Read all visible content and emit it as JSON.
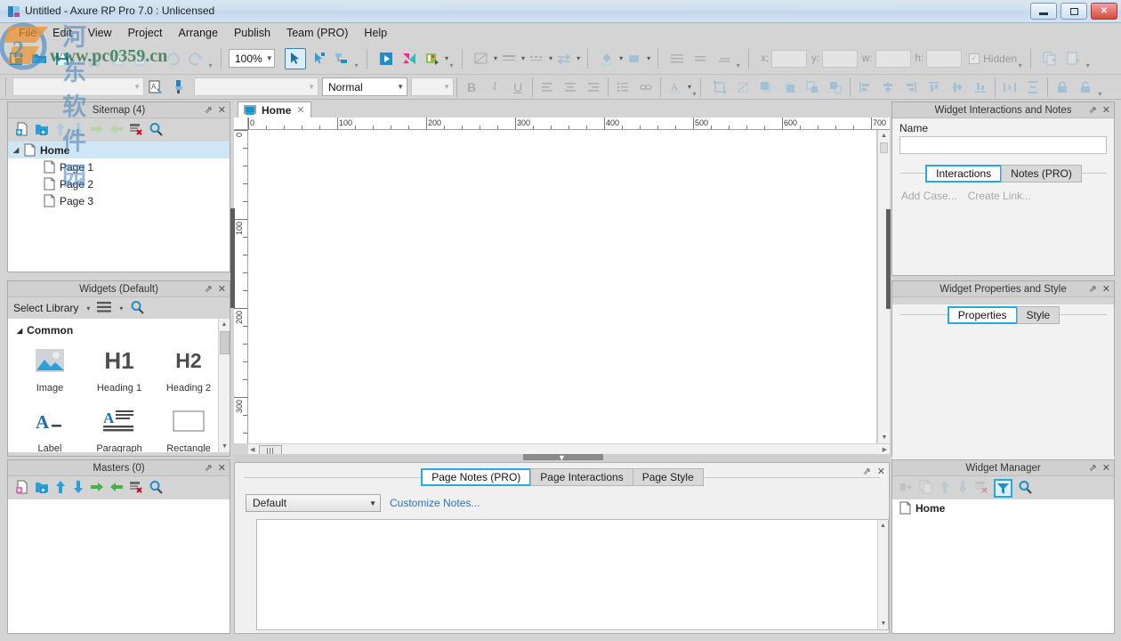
{
  "window": {
    "title": "Untitled - Axure RP Pro 7.0 : Unlicensed",
    "app_icon": "axure-logo-icon",
    "minimize": "minimize-icon",
    "maximize": "maximize-icon",
    "close": "close-icon"
  },
  "menubar": {
    "items": [
      "File",
      "Edit",
      "View",
      "Project",
      "Arrange",
      "Publish",
      "Team (PRO)",
      "Help"
    ]
  },
  "toolbar": {
    "file_group": [
      {
        "name": "new-file-icon",
        "enabled": true
      },
      {
        "name": "open-file-icon",
        "enabled": true
      },
      {
        "name": "save-file-icon",
        "enabled": true
      }
    ],
    "clipboard_group": [
      {
        "name": "cut-icon",
        "enabled": false
      },
      {
        "name": "copy-icon",
        "enabled": false
      },
      {
        "name": "paste-icon",
        "enabled": false
      }
    ],
    "history_group": [
      {
        "name": "undo-icon",
        "enabled": false
      },
      {
        "name": "redo-icon",
        "enabled": false
      }
    ],
    "zoom_value": "100%",
    "select_group": [
      {
        "name": "pointer-tool-icon",
        "enabled": true,
        "active": true
      },
      {
        "name": "connector-tool-icon",
        "enabled": true,
        "active": false
      },
      {
        "name": "relative-tool-icon",
        "enabled": true,
        "active": false
      }
    ],
    "publish_group": [
      {
        "name": "preview-icon",
        "enabled": true
      },
      {
        "name": "publish-icon",
        "enabled": true
      },
      {
        "name": "generate-html-icon",
        "enabled": true
      }
    ],
    "shape_group": [
      {
        "name": "fill-style-icon",
        "enabled": false
      },
      {
        "name": "line-style-icon",
        "enabled": false
      },
      {
        "name": "line-pattern-icon",
        "enabled": false
      },
      {
        "name": "arrow-style-icon",
        "enabled": false
      }
    ],
    "color_group": [
      {
        "name": "fill-color-icon",
        "enabled": false
      },
      {
        "name": "shadow-color-icon",
        "enabled": false
      }
    ],
    "spacing_group": [
      {
        "name": "line-spacing-icon",
        "enabled": false
      },
      {
        "name": "padding-icon",
        "enabled": false
      },
      {
        "name": "text-spacing-icon",
        "enabled": false
      }
    ],
    "geometry": {
      "x_label": "x:",
      "y_label": "y:",
      "w_label": "w:",
      "h_label": "h:",
      "x_value": "",
      "y_value": "",
      "w_value": "",
      "h_value": "",
      "hidden_label": "Hidden"
    },
    "duplicate_group": [
      {
        "name": "duplicate-icon",
        "enabled": false
      },
      {
        "name": "create-master-icon",
        "enabled": false
      }
    ]
  },
  "format_bar": {
    "style_value": "",
    "style_placeholder": "",
    "format_painter_icon": "format-painter-icon",
    "apply-brush-icon": "paint-brush-icon",
    "font_value": "",
    "weight_value": "Normal",
    "size_value": "",
    "bold": "B",
    "italic": "I",
    "underline": "U",
    "align_group": [
      {
        "name": "align-left-icon"
      },
      {
        "name": "align-center-icon"
      },
      {
        "name": "align-right-icon"
      }
    ],
    "list_group": [
      {
        "name": "bullet-list-icon"
      },
      {
        "name": "link-icon"
      }
    ],
    "font_color_icon": "font-color-icon",
    "arrange_group": [
      {
        "name": "group-icon"
      },
      {
        "name": "ungroup-icon"
      },
      {
        "name": "bring-front-icon"
      },
      {
        "name": "send-back-icon"
      },
      {
        "name": "bring-forward-icon"
      },
      {
        "name": "send-backward-icon"
      },
      {
        "name": "align-objects-left-icon"
      },
      {
        "name": "align-objects-center-icon"
      },
      {
        "name": "align-objects-right-icon"
      },
      {
        "name": "align-objects-top-icon"
      },
      {
        "name": "align-objects-middle-icon"
      },
      {
        "name": "align-objects-bottom-icon"
      },
      {
        "name": "distribute-horizontal-icon"
      },
      {
        "name": "distribute-vertical-icon"
      },
      {
        "name": "lock-icon"
      },
      {
        "name": "unlock-icon"
      }
    ]
  },
  "sitemap": {
    "title": "Sitemap (4)",
    "toolbar": [
      {
        "name": "add-page-icon",
        "enabled": true
      },
      {
        "name": "add-folder-icon",
        "enabled": true
      },
      {
        "name": "move-up-icon",
        "enabled": false
      },
      {
        "name": "move-down-icon",
        "enabled": false
      },
      {
        "name": "indent-icon",
        "enabled": false
      },
      {
        "name": "outdent-icon",
        "enabled": false
      },
      {
        "name": "delete-page-icon",
        "enabled": true
      },
      {
        "name": "search-icon",
        "enabled": true
      }
    ],
    "nodes": [
      {
        "label": "Home",
        "level": 0,
        "selected": true,
        "expanded": true
      },
      {
        "label": "Page 1",
        "level": 1,
        "selected": false
      },
      {
        "label": "Page 2",
        "level": 1,
        "selected": false
      },
      {
        "label": "Page 3",
        "level": 1,
        "selected": false
      }
    ]
  },
  "widgets": {
    "title": "Widgets (Default)",
    "select_library": "Select Library",
    "menu_icon": "library-menu-icon",
    "search_icon": "search-icon",
    "group_label": "Common",
    "items": [
      {
        "label": "Image",
        "icon": "image-widget-icon"
      },
      {
        "label": "Heading 1",
        "icon": "h1-widget-icon",
        "glyph": "H1"
      },
      {
        "label": "Heading 2",
        "icon": "h2-widget-icon",
        "glyph": "H2"
      },
      {
        "label": "Label",
        "icon": "label-widget-icon"
      },
      {
        "label": "Paragraph",
        "icon": "paragraph-widget-icon"
      },
      {
        "label": "Rectangle",
        "icon": "rectangle-widget-icon"
      }
    ]
  },
  "masters": {
    "title": "Masters (0)",
    "toolbar": [
      {
        "name": "add-master-icon",
        "enabled": true
      },
      {
        "name": "add-folder-icon",
        "enabled": true
      },
      {
        "name": "move-up-icon",
        "enabled": true
      },
      {
        "name": "move-down-icon",
        "enabled": true
      },
      {
        "name": "indent-icon",
        "enabled": true
      },
      {
        "name": "outdent-icon",
        "enabled": true
      },
      {
        "name": "delete-master-icon",
        "enabled": true
      },
      {
        "name": "search-icon",
        "enabled": true
      }
    ],
    "items": []
  },
  "canvas": {
    "tab_label": "Home",
    "tab_icon": "page-tab-icon",
    "tab_close": "close-icon",
    "ruler_h_labels": [
      "0",
      "100",
      "200",
      "300",
      "400",
      "500",
      "600",
      "700"
    ],
    "ruler_v_labels": [
      "0",
      "100",
      "200",
      "300"
    ],
    "zoom": "100%"
  },
  "page_panel": {
    "tabs": [
      {
        "label": "Page Notes (PRO)",
        "selected": true
      },
      {
        "label": "Page Interactions",
        "selected": false
      },
      {
        "label": "Page Style",
        "selected": false
      }
    ],
    "notes_select_value": "Default",
    "customize_link": "Customize Notes...",
    "notes_text": ""
  },
  "interactions_panel": {
    "title": "Widget Interactions and Notes",
    "name_label": "Name",
    "name_value": "",
    "tabs": [
      {
        "label": "Interactions",
        "selected": true
      },
      {
        "label": "Notes (PRO)",
        "selected": false
      }
    ],
    "add_case_link": "Add Case...",
    "create_link": "Create Link..."
  },
  "properties_panel": {
    "title": "Widget Properties and Style",
    "tabs": [
      {
        "label": "Properties",
        "selected": true
      },
      {
        "label": "Style",
        "selected": false
      }
    ]
  },
  "widget_manager": {
    "title": "Widget Manager",
    "toolbar": [
      {
        "name": "group-widgets-icon",
        "enabled": false
      },
      {
        "name": "duplicate-widget-icon",
        "enabled": false
      },
      {
        "name": "move-up-icon",
        "enabled": false
      },
      {
        "name": "move-down-icon",
        "enabled": false
      },
      {
        "name": "delete-widget-icon",
        "enabled": false
      },
      {
        "name": "filter-icon",
        "enabled": true,
        "active": true
      },
      {
        "name": "search-icon",
        "enabled": true
      }
    ],
    "items": [
      {
        "label": "Home",
        "icon": "page-icon"
      }
    ]
  },
  "watermark": {
    "chinese": "河东软件园",
    "url": "www.pc0359.cn"
  },
  "colors": {
    "accent": "#29a8df",
    "panel_bg": "#d4d4d4",
    "selection": "#cfe6f7",
    "link": "#2a72c0",
    "close_red": "#d94a3a"
  }
}
